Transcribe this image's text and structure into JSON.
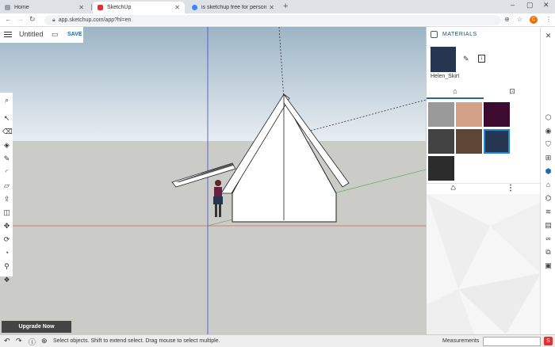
{
  "browser": {
    "tabs": [
      {
        "label": "Home",
        "favicon_color": "#9aa0a6"
      },
      {
        "label": "SketchUp",
        "favicon_color": "#e0312f"
      },
      {
        "label": "is sketchup free for personal use",
        "favicon_color": "#4285f4"
      }
    ],
    "new_tab": "+",
    "url": "app.sketchup.com/app?hl=en",
    "profile_initial": "C"
  },
  "app": {
    "title": "Untitled",
    "save_label": "SAVE",
    "upgrade_label": "Upgrade Now"
  },
  "toolbar": {
    "tools": [
      "search-icon",
      "select-icon",
      "eraser-icon",
      "paint-bucket-icon",
      "line-icon",
      "arc-icon",
      "rectangle-icon",
      "push-pull-icon",
      "offset-icon",
      "move-icon",
      "rotate-icon",
      "tape-measure-icon",
      "walk-icon",
      "orbit-icon"
    ]
  },
  "status": {
    "message": "Select objects. Shift to extend select. Drag mouse to select multiple.",
    "measurements_label": "Measurements"
  },
  "panel": {
    "title": "MATERIALS",
    "material_name": "Helen_Skirt",
    "preview_color": "#263550",
    "swatches": [
      {
        "color": "#9a9a9a",
        "selected": false
      },
      {
        "color": "#d4a086",
        "selected": false
      },
      {
        "color": "#3d0b30",
        "selected": false
      },
      {
        "color": "#424242",
        "selected": false
      },
      {
        "color": "#5e4536",
        "selected": false
      },
      {
        "color": "#263550",
        "selected": true
      },
      {
        "color": "#2c2c2c",
        "selected": false
      }
    ],
    "accent": "#1b6ca8"
  },
  "rightrail": {
    "icons": [
      "help-icon",
      "instructor-icon",
      "components-icon",
      "materials-icon",
      "styles-icon",
      "layers-icon",
      "scenes-icon",
      "display-icon",
      "views-icon",
      "outliner-icon",
      "model-info-icon",
      "library-icon"
    ]
  }
}
